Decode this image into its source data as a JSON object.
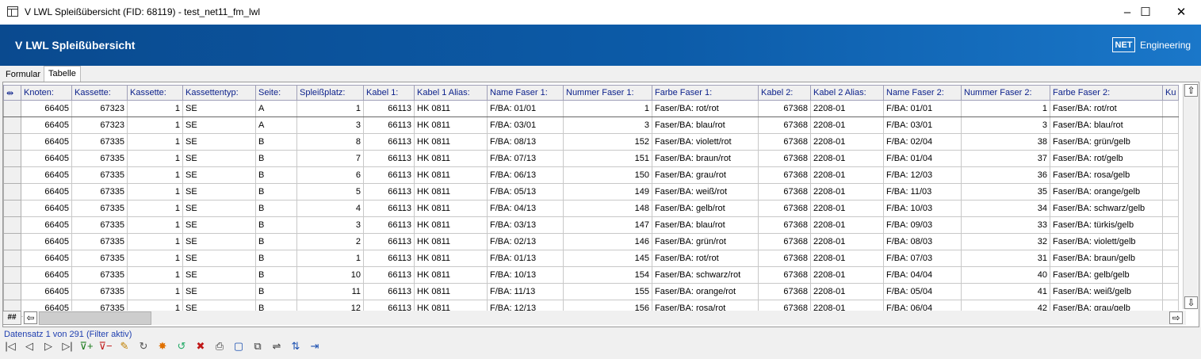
{
  "window": {
    "title": "V LWL Spleißübersicht (FID: 68119) - test_net11_fm_lwl",
    "min": "–",
    "max": "☐",
    "close": "✕"
  },
  "banner": {
    "title": "V LWL Spleißübersicht",
    "logo_box": "NET",
    "logo_text": "Engineering"
  },
  "tabs": [
    "Formular",
    "Tabelle"
  ],
  "grid": {
    "corner": "⇹",
    "columns": [
      "Knoten:",
      "Kassette:",
      "Kassette:",
      "Kassettentyp:",
      "Seite:",
      "Spleißplatz:",
      "Kabel 1:",
      "Kabel 1 Alias:",
      "Name Faser 1:",
      "Nummer Faser 1:",
      "Farbe Faser 1:",
      "Kabel 2:",
      "Kabel 2 Alias:",
      "Name Faser 2:",
      "Nummer Faser 2:",
      "Farbe Faser 2:",
      "Ku"
    ],
    "rows": [
      [
        "66405",
        "67323",
        "1",
        "SE",
        "A",
        "1",
        "66113",
        "HK 0811",
        "F/BA: 01/01",
        "1",
        "Faser/BA: rot/rot",
        "67368",
        "2208-01",
        "F/BA: 01/01",
        "1",
        "Faser/BA: rot/rot"
      ],
      [
        "66405",
        "67323",
        "1",
        "SE",
        "A",
        "3",
        "66113",
        "HK 0811",
        "F/BA: 03/01",
        "3",
        "Faser/BA: blau/rot",
        "67368",
        "2208-01",
        "F/BA: 03/01",
        "3",
        "Faser/BA: blau/rot"
      ],
      [
        "66405",
        "67335",
        "1",
        "SE",
        "B",
        "8",
        "66113",
        "HK 0811",
        "F/BA: 08/13",
        "152",
        "Faser/BA: violett/rot",
        "67368",
        "2208-01",
        "F/BA: 02/04",
        "38",
        "Faser/BA: grün/gelb"
      ],
      [
        "66405",
        "67335",
        "1",
        "SE",
        "B",
        "7",
        "66113",
        "HK 0811",
        "F/BA: 07/13",
        "151",
        "Faser/BA: braun/rot",
        "67368",
        "2208-01",
        "F/BA: 01/04",
        "37",
        "Faser/BA: rot/gelb"
      ],
      [
        "66405",
        "67335",
        "1",
        "SE",
        "B",
        "6",
        "66113",
        "HK 0811",
        "F/BA: 06/13",
        "150",
        "Faser/BA: grau/rot",
        "67368",
        "2208-01",
        "F/BA: 12/03",
        "36",
        "Faser/BA: rosa/gelb"
      ],
      [
        "66405",
        "67335",
        "1",
        "SE",
        "B",
        "5",
        "66113",
        "HK 0811",
        "F/BA: 05/13",
        "149",
        "Faser/BA: weiß/rot",
        "67368",
        "2208-01",
        "F/BA: 11/03",
        "35",
        "Faser/BA: orange/gelb"
      ],
      [
        "66405",
        "67335",
        "1",
        "SE",
        "B",
        "4",
        "66113",
        "HK 0811",
        "F/BA: 04/13",
        "148",
        "Faser/BA: gelb/rot",
        "67368",
        "2208-01",
        "F/BA: 10/03",
        "34",
        "Faser/BA: schwarz/gelb"
      ],
      [
        "66405",
        "67335",
        "1",
        "SE",
        "B",
        "3",
        "66113",
        "HK 0811",
        "F/BA: 03/13",
        "147",
        "Faser/BA: blau/rot",
        "67368",
        "2208-01",
        "F/BA: 09/03",
        "33",
        "Faser/BA: türkis/gelb"
      ],
      [
        "66405",
        "67335",
        "1",
        "SE",
        "B",
        "2",
        "66113",
        "HK 0811",
        "F/BA: 02/13",
        "146",
        "Faser/BA: grün/rot",
        "67368",
        "2208-01",
        "F/BA: 08/03",
        "32",
        "Faser/BA: violett/gelb"
      ],
      [
        "66405",
        "67335",
        "1",
        "SE",
        "B",
        "1",
        "66113",
        "HK 0811",
        "F/BA: 01/13",
        "145",
        "Faser/BA: rot/rot",
        "67368",
        "2208-01",
        "F/BA: 07/03",
        "31",
        "Faser/BA: braun/gelb"
      ],
      [
        "66405",
        "67335",
        "1",
        "SE",
        "B",
        "10",
        "66113",
        "HK 0811",
        "F/BA: 10/13",
        "154",
        "Faser/BA: schwarz/rot",
        "67368",
        "2208-01",
        "F/BA: 04/04",
        "40",
        "Faser/BA: gelb/gelb"
      ],
      [
        "66405",
        "67335",
        "1",
        "SE",
        "B",
        "11",
        "66113",
        "HK 0811",
        "F/BA: 11/13",
        "155",
        "Faser/BA: orange/rot",
        "67368",
        "2208-01",
        "F/BA: 05/04",
        "41",
        "Faser/BA: weiß/gelb"
      ],
      [
        "66405",
        "67335",
        "1",
        "SE",
        "B",
        "12",
        "66113",
        "HK 0811",
        "F/BA: 12/13",
        "156",
        "Faser/BA: rosa/rot",
        "67368",
        "2208-01",
        "F/BA: 06/04",
        "42",
        "Faser/BA: grau/gelb"
      ]
    ]
  },
  "scroll": {
    "up": "⇧",
    "down": "⇩",
    "left": "⇦",
    "right": "⇨",
    "hash": "##"
  },
  "status": "Datensatz 1 von 291 (Filter aktiv)",
  "toolbar": [
    "|◁",
    "◁",
    "▷",
    "▷|",
    "⊽+",
    "⊽−",
    "✎",
    "↻",
    "✸",
    "↺",
    "✖",
    "⎙",
    "▢",
    "⧉",
    "⇌",
    "⇅",
    "⇥"
  ]
}
